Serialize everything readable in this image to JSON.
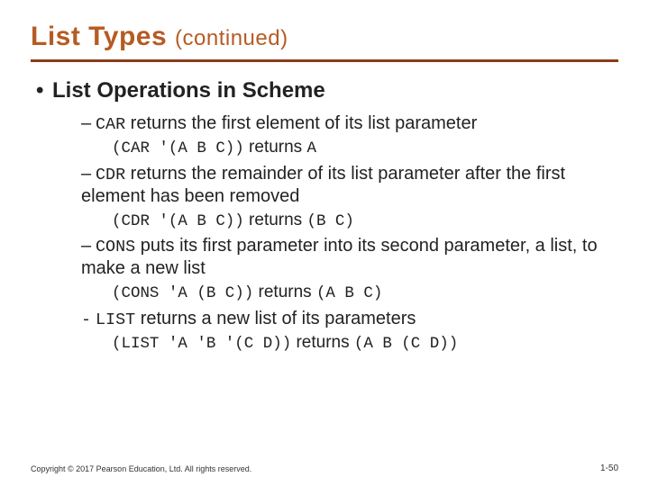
{
  "title": {
    "main": "List Types",
    "sub": "(continued)"
  },
  "heading": "List Operations in Scheme",
  "items": [
    {
      "fn": "CAR",
      "desc": " returns the first element of its list parameter",
      "ex_code": "(CAR ′(A B C))",
      "ex_mid": " returns ",
      "ex_res": "A"
    },
    {
      "fn": "CDR",
      "desc": " returns the remainder of its list parameter after the first element has been removed",
      "ex_code": "(CDR ′(A B C))",
      "ex_mid": " returns ",
      "ex_res": "(B C)"
    },
    {
      "fn": "CONS",
      "desc": " puts its first parameter into its second parameter, a list, to make a new list",
      "ex_code": "(CONS ′A (B C))",
      "ex_mid": " returns ",
      "ex_res": "(A B C)"
    },
    {
      "fn": "LIST",
      "desc": " returns a new list of its parameters",
      "ex_code": "(LIST ′A ′B ′(C D))",
      "ex_mid": " returns ",
      "ex_res": "(A B (C D))"
    }
  ],
  "footer": "Copyright © 2017 Pearson Education, Ltd. All rights reserved.",
  "pagenum": "1-50"
}
